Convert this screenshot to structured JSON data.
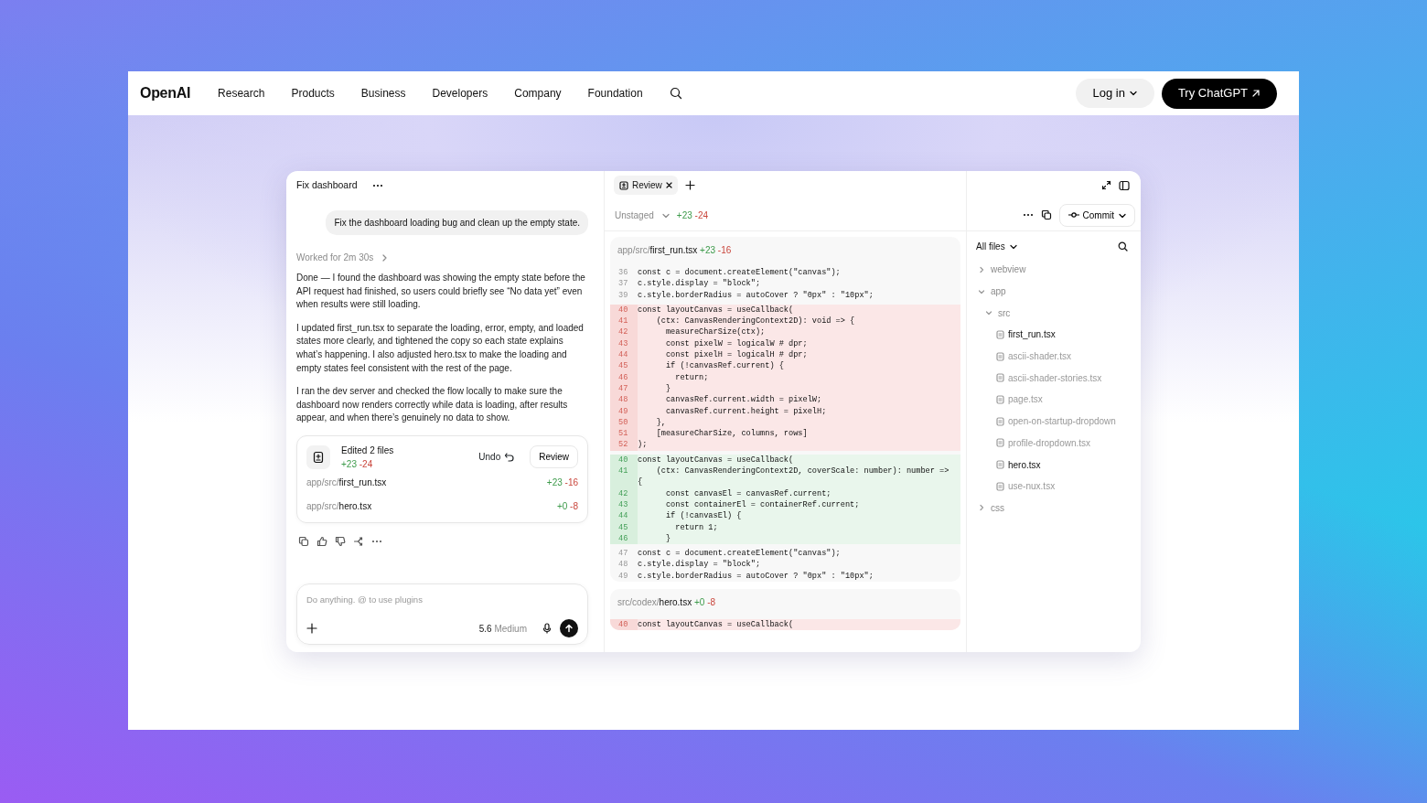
{
  "nav": {
    "logo": "OpenAI",
    "links": [
      "Research",
      "Products",
      "Business",
      "Developers",
      "Company",
      "Foundation"
    ],
    "login": "Log in",
    "cta": "Try ChatGPT"
  },
  "chat": {
    "title": "Fix dashboard",
    "user_message": "Fix the dashboard loading bug and clean up the empty state.",
    "worked": "Worked for 2m 30s",
    "paragraphs": [
      "Done — I found the dashboard was showing the empty state before the API request had finished, so users could briefly see “No data yet” even when results were still loading.",
      "I updated first_run.tsx to separate the loading, error, empty, and loaded states more clearly, and tightened the copy so each state explains what’s happening. I also adjusted hero.tsx to make the loading and empty states feel consistent with the rest of the page.",
      "I ran the dev server and checked the flow locally to make sure the dashboard now renders correctly while data is loading, after results appear, and when there’s genuinely no data to show."
    ],
    "edits": {
      "title": "Edited 2 files",
      "added": "+23",
      "removed": "-24",
      "undo": "Undo",
      "review": "Review",
      "files": [
        {
          "dir": "app/src/",
          "name": "first_run.tsx",
          "added": "+23",
          "removed": "-16"
        },
        {
          "dir": "app/src/",
          "name": "hero.tsx",
          "added": "+0",
          "removed": "-8"
        }
      ]
    },
    "composer": {
      "placeholder": "Do anything. @ to use plugins",
      "model": "5.6",
      "effort": "Medium"
    }
  },
  "review": {
    "tabs": [
      {
        "label": "Review",
        "selected": true
      }
    ],
    "filter": "Unstaged",
    "added": "+23",
    "removed": "-24",
    "commit": "Commit",
    "diffs": [
      {
        "dir": "app/src/",
        "name": "first_run.tsx",
        "added": "+23",
        "removed": "-16",
        "lines": [
          {
            "kind": "context",
            "num": "36",
            "code": "const c = document.createElement(\"canvas\");"
          },
          {
            "kind": "context",
            "num": "37",
            "code": "c.style.display = \"block\";"
          },
          {
            "kind": "context",
            "num": "39",
            "code": "c.style.borderRadius = autoCover ? \"0px\" : \"10px\";"
          },
          {
            "kind": "removed",
            "num": "40",
            "code": "const layoutCanvas = useCallback("
          },
          {
            "kind": "removed",
            "num": "41",
            "code": "    (ctx: CanvasRenderingContext2D): void => {"
          },
          {
            "kind": "removed",
            "num": "42",
            "code": "      measureCharSize(ctx);"
          },
          {
            "kind": "removed",
            "num": "43",
            "code": "      const pixelW = logicalW # dpr;"
          },
          {
            "kind": "removed",
            "num": "44",
            "code": "      const pixelH = logicalH # dpr;"
          },
          {
            "kind": "removed",
            "num": "45",
            "code": "      if (!canvasRef.current) {"
          },
          {
            "kind": "removed",
            "num": "46",
            "code": "        return;"
          },
          {
            "kind": "removed",
            "num": "47",
            "code": "      }"
          },
          {
            "kind": "removed",
            "num": "48",
            "code": "      canvasRef.current.width = pixelW;"
          },
          {
            "kind": "removed",
            "num": "49",
            "code": "      canvasRef.current.height = pixelH;"
          },
          {
            "kind": "removed",
            "num": "50",
            "code": "    },"
          },
          {
            "kind": "removed",
            "num": "51",
            "code": "    [measureCharSize, columns, rows]"
          },
          {
            "kind": "removed",
            "num": "52",
            "code": ");"
          },
          {
            "kind": "added",
            "num": "40",
            "code": "const layoutCanvas = useCallback("
          },
          {
            "kind": "added",
            "num": "41",
            "code": "    (ctx: CanvasRenderingContext2D, coverScale: number): number =>"
          },
          {
            "kind": "added",
            "code": "{"
          },
          {
            "kind": "added",
            "num": "42",
            "code": "      const canvasEl = canvasRef.current;"
          },
          {
            "kind": "added",
            "num": "43",
            "code": "      const containerEl = containerRef.current;"
          },
          {
            "kind": "added",
            "num": "44",
            "code": "      if (!canvasEl) {"
          },
          {
            "kind": "added",
            "num": "45",
            "code": "        return 1;"
          },
          {
            "kind": "added",
            "num": "46",
            "code": "      }"
          },
          {
            "kind": "context",
            "num": "47",
            "code": "const c = document.createElement(\"canvas\");"
          },
          {
            "kind": "context",
            "num": "48",
            "code": "c.style.display = \"block\";"
          },
          {
            "kind": "context",
            "num": "49",
            "code": "c.style.borderRadius = autoCover ? \"0px\" : \"10px\";"
          }
        ]
      },
      {
        "dir": "src/codex/",
        "name": "hero.tsx",
        "added": "+0",
        "removed": "-8",
        "lines": [
          {
            "kind": "removed",
            "num": "40",
            "code": "const layoutCanvas = useCallback("
          }
        ]
      }
    ]
  },
  "files": {
    "filter": "All files",
    "tree": [
      {
        "name": "webview",
        "kind": "folder",
        "expanded": false
      },
      {
        "name": "app",
        "kind": "folder",
        "expanded": true,
        "children": [
          {
            "name": "src",
            "kind": "folder",
            "expanded": true,
            "children": [
              {
                "name": "first_run.tsx",
                "kind": "file",
                "modified": true
              },
              {
                "name": "ascii-shader.tsx",
                "kind": "file",
                "modified": false
              },
              {
                "name": "ascii-shader-stories.tsx",
                "kind": "file",
                "modified": false
              },
              {
                "name": "page.tsx",
                "kind": "file",
                "modified": false
              },
              {
                "name": "open-on-startup-dropdown",
                "kind": "file",
                "modified": false
              },
              {
                "name": "profile-dropdown.tsx",
                "kind": "file",
                "modified": false
              },
              {
                "name": "hero.tsx",
                "kind": "file",
                "modified": true
              },
              {
                "name": "use-nux.tsx",
                "kind": "file",
                "modified": false
              }
            ]
          }
        ]
      },
      {
        "name": "css",
        "kind": "folder",
        "expanded": false
      }
    ]
  }
}
